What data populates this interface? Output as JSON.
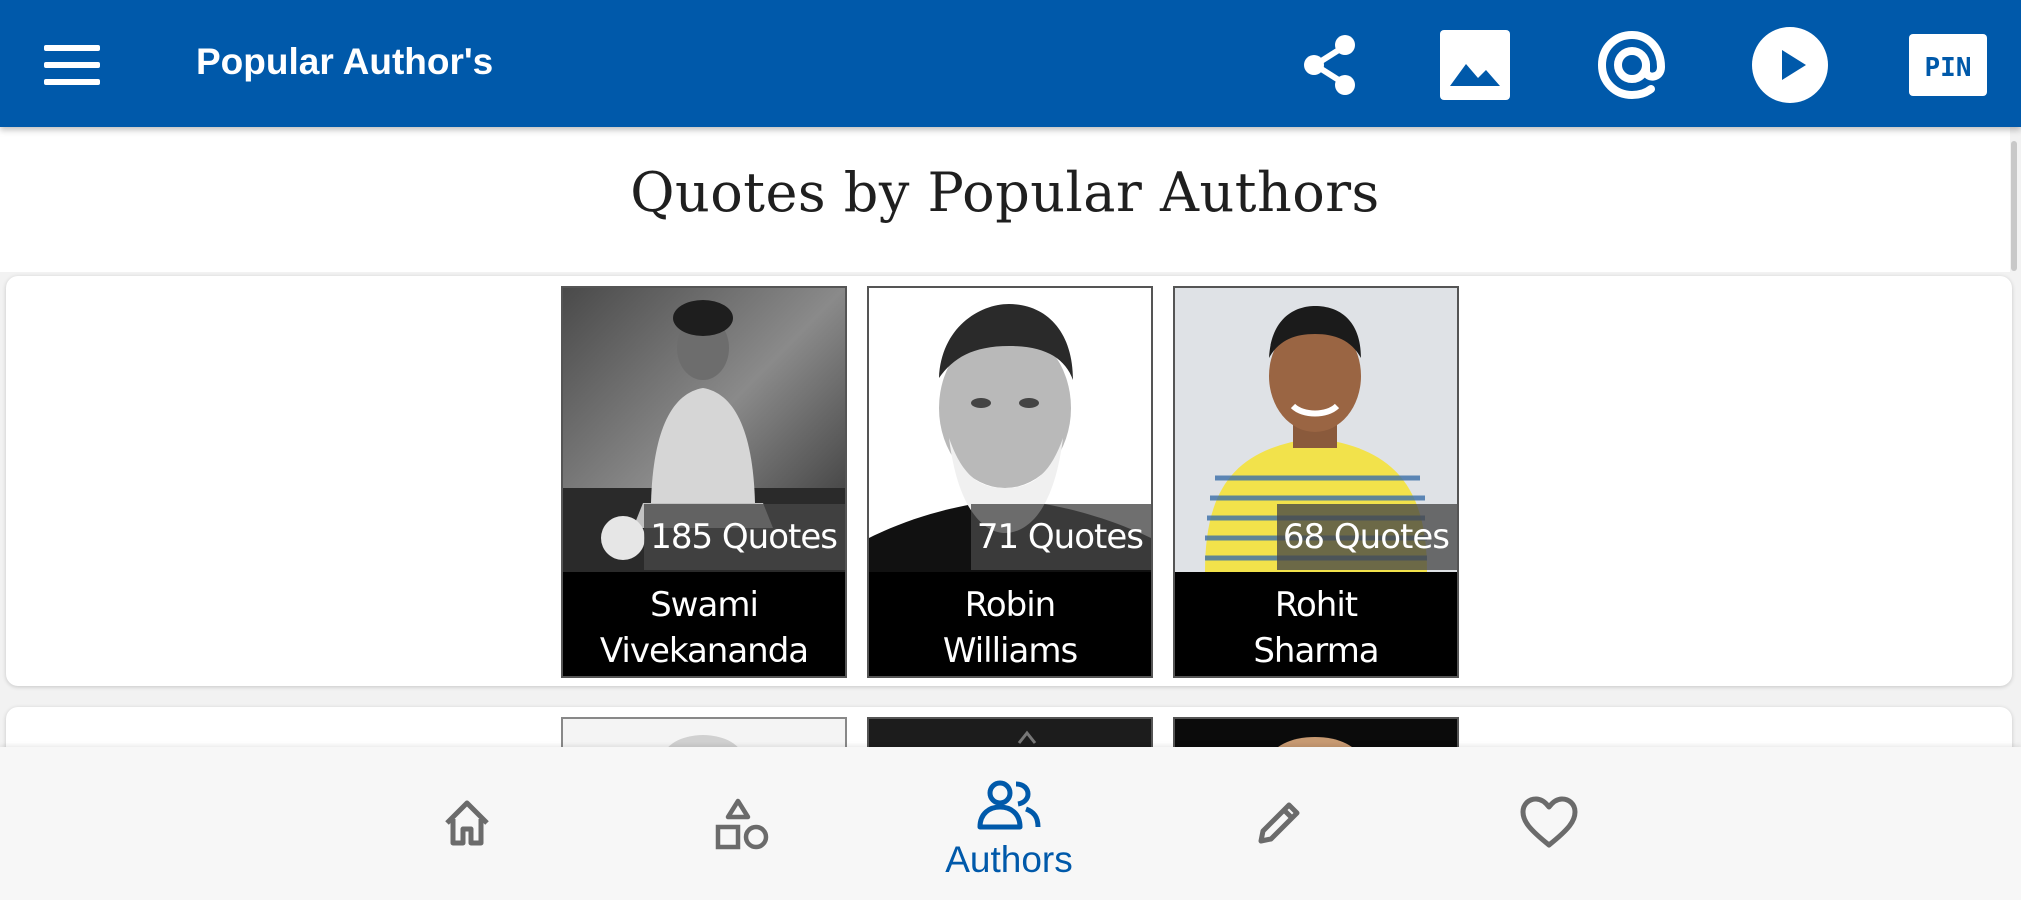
{
  "appbar": {
    "title": "Popular Author's",
    "icons": [
      "menu-icon",
      "share-icon",
      "image-icon",
      "at-icon",
      "play-icon",
      "pin-icon"
    ],
    "pin_label": "PIN",
    "background": "#0059aa"
  },
  "content": {
    "heading": "Quotes by Popular Authors"
  },
  "authors": [
    {
      "count": "185 Quotes",
      "name_line1": "Swami",
      "name_line2": "Vivekananda"
    },
    {
      "count": "71 Quotes",
      "name_line1": "Robin",
      "name_line2": "Williams"
    },
    {
      "count": "68 Quotes",
      "name_line1": "Rohit",
      "name_line2": "Sharma"
    }
  ],
  "bottom_nav": {
    "items": [
      {
        "icon": "home-icon",
        "label": ""
      },
      {
        "icon": "categories-icon",
        "label": ""
      },
      {
        "icon": "authors-icon",
        "label": "Authors",
        "active": true
      },
      {
        "icon": "pencil-icon",
        "label": ""
      },
      {
        "icon": "heart-icon",
        "label": ""
      }
    ],
    "active_color": "#0059aa",
    "inactive_color": "#6b6b6b"
  }
}
